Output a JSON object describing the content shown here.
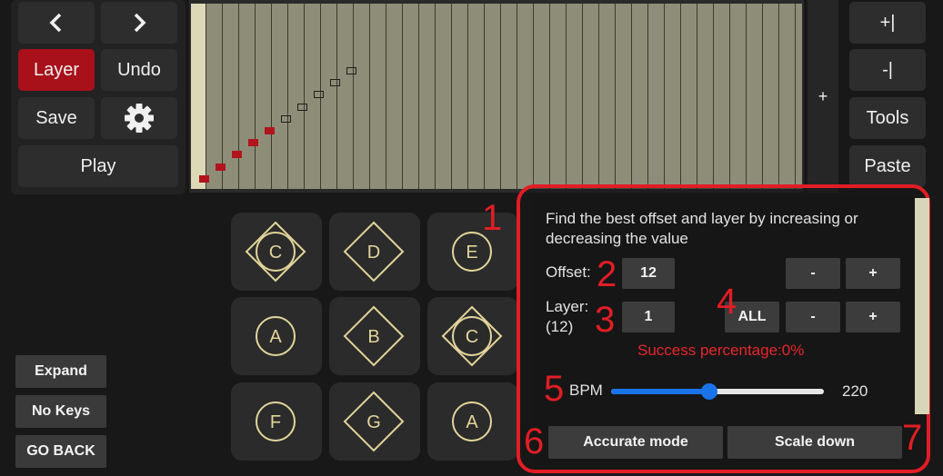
{
  "toolbar": {
    "prev_icon": "chevron-left-icon",
    "next_icon": "chevron-right-icon",
    "layer_label": "Layer",
    "undo_label": "Undo",
    "save_label": "Save",
    "settings_icon": "gear-icon",
    "play_label": "Play"
  },
  "roll": {
    "add_column_label": "+"
  },
  "right_tools": {
    "insert_label": "+|",
    "remove_label": "-|",
    "tools_label": "Tools",
    "paste_label": "Paste"
  },
  "left_side": {
    "expand_label": "Expand",
    "no_keys_label": "No Keys",
    "go_back_label": "GO BACK"
  },
  "keypad": [
    {
      "label": "C",
      "shape": "circle-diamond"
    },
    {
      "label": "D",
      "shape": "diamond"
    },
    {
      "label": "E",
      "shape": "circle"
    },
    {
      "label": "A",
      "shape": "circle"
    },
    {
      "label": "B",
      "shape": "diamond"
    },
    {
      "label": "C",
      "shape": "circle-diamond"
    },
    {
      "label": "F",
      "shape": "circle"
    },
    {
      "label": "G",
      "shape": "diamond"
    },
    {
      "label": "A",
      "shape": "circle"
    }
  ],
  "dialog": {
    "instructions": "Find the best offset and layer by increasing or decreasing the value",
    "offset_label": "Offset:",
    "offset_value": "12",
    "layer_label": "Layer:",
    "layer_count": "(12)",
    "layer_value": "1",
    "all_label": "ALL",
    "minus_label": "-",
    "plus_label": "+",
    "success_text": "Success percentage:0%",
    "bpm_label": "BPM",
    "bpm_value": "220",
    "bpm_slider_fraction": 0.46,
    "accurate_mode_label": "Accurate mode",
    "scale_down_label": "Scale down"
  },
  "annotations": [
    "1",
    "2",
    "3",
    "4",
    "5",
    "6",
    "7"
  ],
  "colors": {
    "accent_red": "#a8101a",
    "annotation_red": "#e21d25",
    "slider_blue": "#1a73e8",
    "success_red": "#e8262d",
    "roll_cell": "#8e8e78"
  }
}
